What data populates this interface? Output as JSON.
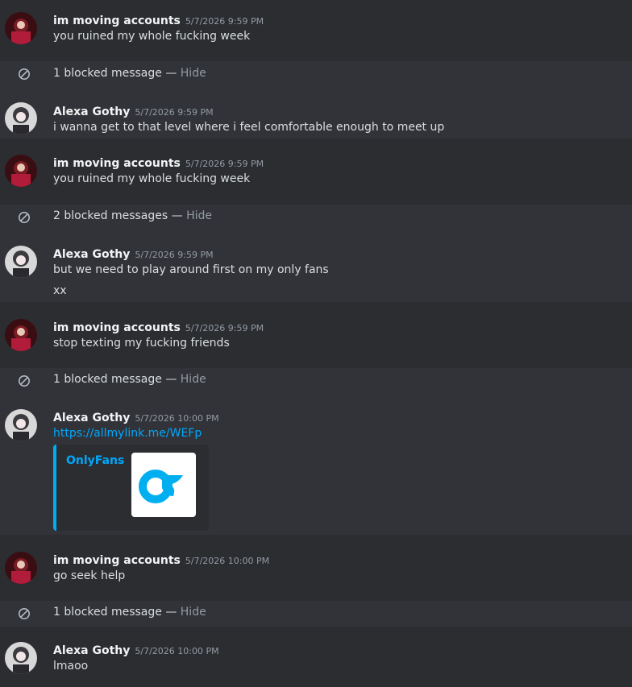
{
  "blocked": {
    "one": "1 blocked message",
    "two": "2 blocked messages",
    "separator": " — ",
    "hide": "Hide"
  },
  "messages": [
    {
      "author": "im moving accounts",
      "time": "5/7/2026 9:59 PM",
      "text": "you ruined my whole fucking week"
    },
    {
      "author": "Alexa Gothy",
      "time": "5/7/2026 9:59 PM",
      "text": "i wanna get to that level where i feel comfortable enough to meet up"
    },
    {
      "author": "im moving accounts",
      "time": "5/7/2026 9:59 PM",
      "text": "you ruined my whole fucking week"
    },
    {
      "author": "Alexa Gothy",
      "time": "5/7/2026 9:59 PM",
      "text": "but we need to play around first on my only fans",
      "text2": "xx"
    },
    {
      "author": "im moving accounts",
      "time": "5/7/2026 9:59 PM",
      "text": "stop texting my fucking friends"
    },
    {
      "author": "Alexa Gothy",
      "time": "5/7/2026 10:00 PM",
      "link": "https://allmylink.me/WEFp",
      "embed_title": "OnlyFans"
    },
    {
      "author": "im moving accounts",
      "time": "5/7/2026 10:00 PM",
      "text": "go seek help"
    },
    {
      "author": "Alexa Gothy",
      "time": "5/7/2026 10:00 PM",
      "text": "lmaoo"
    }
  ],
  "colors": {
    "background": "#313338",
    "dark_row": "#2b2d31",
    "link": "#00a8fc",
    "embed_accent": "#00aff0"
  }
}
